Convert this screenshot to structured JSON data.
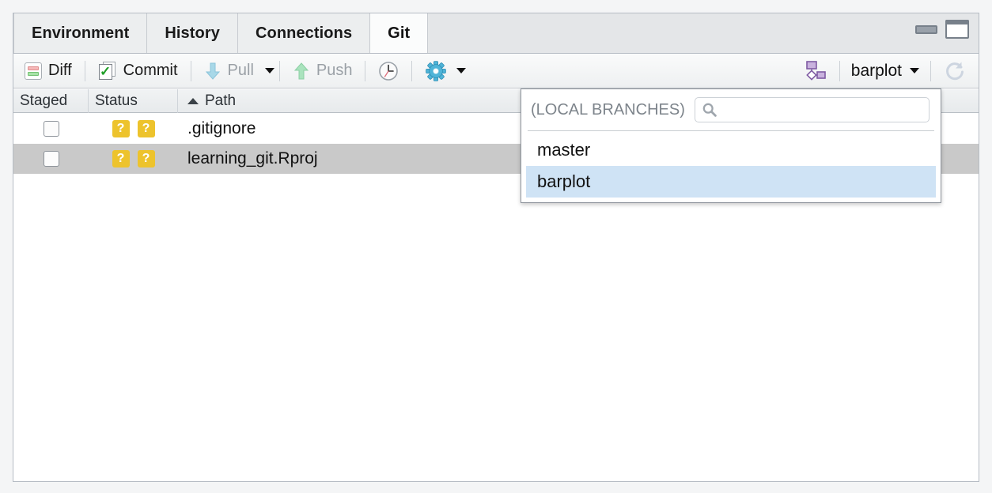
{
  "window": {
    "minimize_label": "Minimize",
    "maximize_label": "Maximize"
  },
  "tabs": [
    {
      "label": "Environment",
      "active": false
    },
    {
      "label": "History",
      "active": false
    },
    {
      "label": "Connections",
      "active": false
    },
    {
      "label": "Git",
      "active": true
    }
  ],
  "toolbar": {
    "diff_label": "Diff",
    "commit_label": "Commit",
    "pull_label": "Pull",
    "push_label": "Push",
    "history_tooltip": "History",
    "more_tooltip": "More",
    "branchnet_tooltip": "Git branch network",
    "branch_label": "barplot",
    "refresh_tooltip": "Refresh"
  },
  "table": {
    "columns": [
      "Staged",
      "Status",
      "Path"
    ],
    "sort_column": "Path",
    "sort_direction": "asc",
    "rows": [
      {
        "staged": false,
        "status_badges": [
          "?",
          "?"
        ],
        "path": ".gitignore",
        "selected": false
      },
      {
        "staged": false,
        "status_badges": [
          "?",
          "?"
        ],
        "path": "learning_git.Rproj",
        "selected": true
      }
    ]
  },
  "branch_popup": {
    "section_label": "(LOCAL BRANCHES)",
    "search_placeholder": "",
    "search_value": "",
    "items": [
      {
        "label": "master",
        "highlighted": false
      },
      {
        "label": "barplot",
        "highlighted": true
      }
    ]
  },
  "colors": {
    "status_badge": "#edc32d",
    "popup_highlight": "#cfe3f5",
    "row_selected": "#c9c9c9",
    "accent_gear": "#4fb4d8"
  }
}
